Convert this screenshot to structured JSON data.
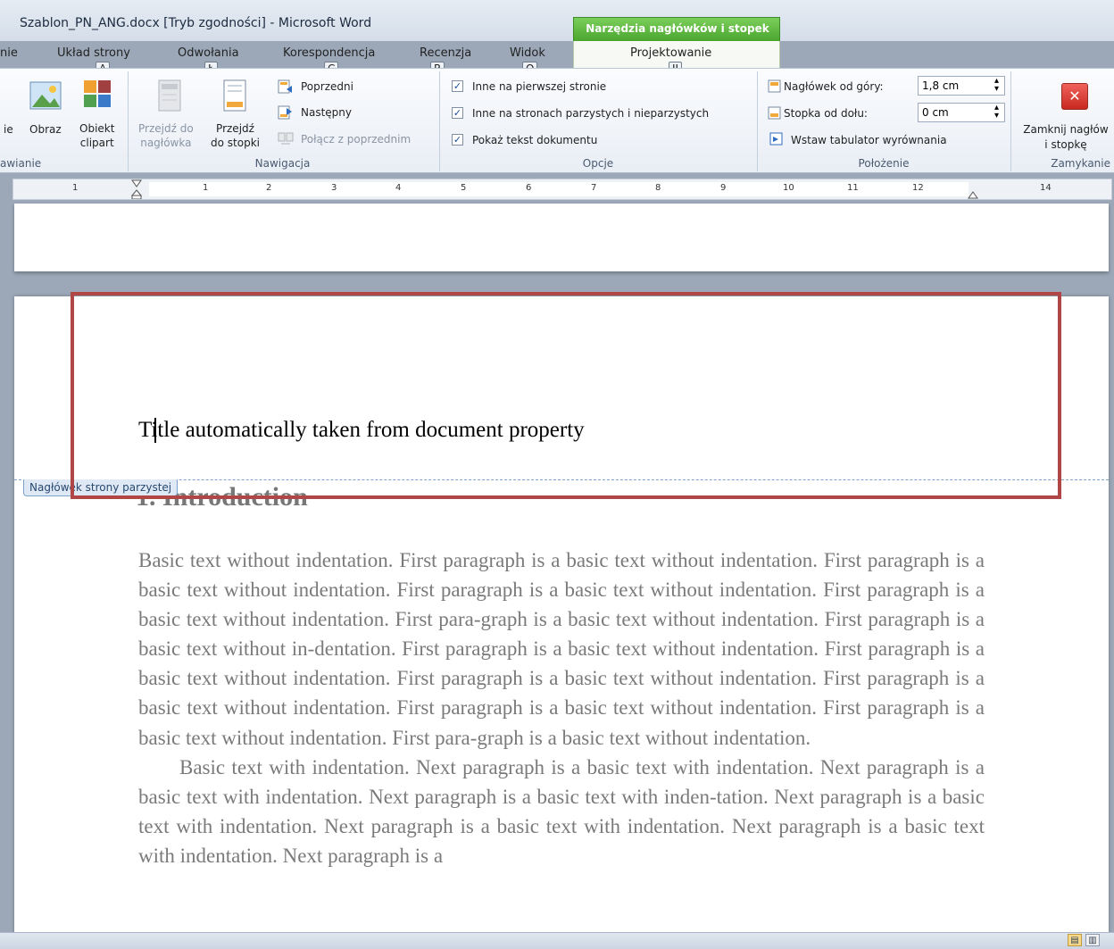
{
  "window": {
    "title": "Szablon_PN_ANG.docx [Tryb zgodności] - Microsoft Word",
    "context_tab_title": "Narzędzia nagłówków i stopek"
  },
  "tabs": [
    {
      "label": "nie"
    },
    {
      "label": "Układ strony",
      "keytip": "A"
    },
    {
      "label": "Odwołania",
      "keytip": "Ł"
    },
    {
      "label": "Korespondencja",
      "keytip": "C"
    },
    {
      "label": "Recenzja",
      "keytip": "R"
    },
    {
      "label": "Widok",
      "keytip": "O"
    },
    {
      "label": "Projektowanie",
      "keytip": "JJ"
    }
  ],
  "ribbon": {
    "insert": {
      "partial_label": "ie",
      "picture_label": "Obraz",
      "clipart_label_1": "Obiekt",
      "clipart_label_2": "clipart",
      "group_label": "awianie"
    },
    "navigation": {
      "goto_header_1": "Przejdź do",
      "goto_header_2": "nagłówka",
      "goto_footer_1": "Przejdź",
      "goto_footer_2": "do stopki",
      "previous": "Poprzedni",
      "next": "Następny",
      "link_previous": "Połącz z poprzednim",
      "group_label": "Nawigacja"
    },
    "options": {
      "different_first": "Inne na pierwszej stronie",
      "different_odd_even": "Inne na stronach parzystych i nieparzystych",
      "show_document_text": "Pokaż tekst dokumentu",
      "group_label": "Opcje"
    },
    "position": {
      "header_from_top_label": "Nagłówek od góry:",
      "header_from_top_value": "1,8 cm",
      "footer_from_bottom_label": "Stopka od dołu:",
      "footer_from_bottom_value": "0 cm",
      "insert_alignment_tab": "Wstaw tabulator wyrównania",
      "group_label": "Położenie"
    },
    "close": {
      "label_1": "Zamknij nagłów",
      "label_2": "i stopkę",
      "group_label": "Zamykanie"
    }
  },
  "ruler": {
    "left_numbers": [
      "1"
    ],
    "numbers": [
      "1",
      "2",
      "3",
      "4",
      "5",
      "6",
      "7",
      "8",
      "9",
      "10",
      "11",
      "12",
      "14"
    ]
  },
  "document": {
    "header_title": "Title automatically taken from document property",
    "header_tag": "Nagłówek strony parzystej",
    "section_heading": "1. Introduction",
    "paragraph1": "Basic text without indentation. First paragraph is a basic text without indentation. First paragraph is a basic text without indentation. First paragraph is a basic text without indentation. First paragraph is a basic text without indentation. First para-graph is a basic text without indentation. First paragraph is a basic text without in-dentation. First paragraph is a basic text without indentation. First paragraph is a basic text without indentation. First paragraph is a basic text without indentation. First paragraph is a basic text without indentation. First paragraph is a basic text without indentation. First paragraph is a basic text without indentation. First para-graph is a basic text without indentation.",
    "paragraph2": "Basic text with indentation. Next paragraph is a basic text with indentation. Next paragraph is a basic text with indentation. Next paragraph is a basic text with inden-tation. Next paragraph is a basic text with indentation. Next paragraph is a basic text with indentation. Next paragraph is a basic text with indentation. Next paragraph is a"
  },
  "colors": {
    "context_tab": "#4aa52f",
    "highlight_box": "#b04646",
    "header_boundary": "#7fa2cc",
    "close_button": "#d9322c"
  }
}
